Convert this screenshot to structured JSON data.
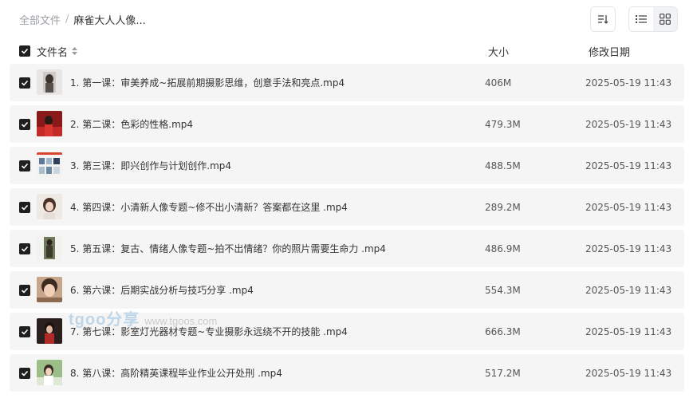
{
  "breadcrumb": {
    "root": "全部文件",
    "separator": "/",
    "current": "麻雀大人人像..."
  },
  "toolbar": {
    "sort_icon": "sort-icon",
    "list_view_icon": "list-view-icon",
    "grid_view_icon": "grid-view-icon"
  },
  "table": {
    "headers": {
      "name": "文件名",
      "size": "大小",
      "date": "修改日期"
    },
    "rows": [
      {
        "name": "1. 第一课：审美养成~拓展前期摄影思维，创意手法和亮点.mp4",
        "size": "406M",
        "date": "2025-05-19 11:43"
      },
      {
        "name": "2. 第二课：色彩的性格.mp4",
        "size": "479.3M",
        "date": "2025-05-19 11:43"
      },
      {
        "name": "3. 第三课：即兴创作与计划创作.mp4",
        "size": "488.5M",
        "date": "2025-05-19 11:43"
      },
      {
        "name": "4. 第四课：小清新人像专题~修不出小清新？答案都在这里 .mp4",
        "size": "289.2M",
        "date": "2025-05-19 11:43"
      },
      {
        "name": "5. 第五课：复古、情绪人像专题~拍不出情绪？你的照片需要生命力 .mp4",
        "size": "486.9M",
        "date": "2025-05-19 11:43"
      },
      {
        "name": "6. 第六课：后期实战分析与技巧分享 .mp4",
        "size": "554.3M",
        "date": "2025-05-19 11:43"
      },
      {
        "name": "7. 第七课：影室灯光器材专题~专业摄影永远绕不开的技能 .mp4",
        "size": "666.3M",
        "date": "2025-05-19 11:43"
      },
      {
        "name": "8. 第八课：高阶精英课程毕业作业公开处刑 .mp4",
        "size": "517.2M",
        "date": "2025-05-19 11:43"
      }
    ]
  },
  "watermark": {
    "brand": "tgoo分享",
    "url": "www.tgoos.com"
  },
  "colors": {
    "row_bg": "#f5f5f6",
    "checkbox": "#1f1f1f",
    "text": "#333333",
    "muted": "#9aa0a6"
  }
}
